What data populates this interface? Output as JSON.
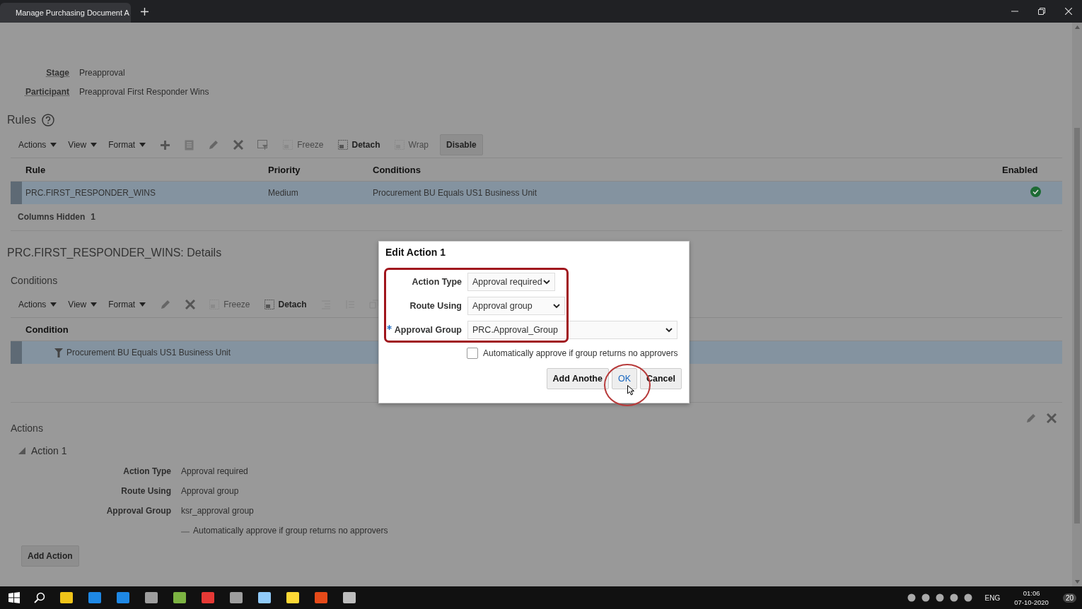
{
  "browser": {
    "tab_title": "Manage Purchasing Document A"
  },
  "header_fields": [
    {
      "label": "Stage",
      "value": "Preapproval"
    },
    {
      "label": "Participant",
      "value": "Preapproval First Responder Wins"
    }
  ],
  "rules": {
    "title": "Rules",
    "menus": [
      "Actions",
      "View",
      "Format"
    ],
    "tools": [
      {
        "label": "Freeze",
        "disabled": true
      },
      {
        "label": "Detach",
        "disabled": false
      },
      {
        "label": "Wrap",
        "disabled": true
      }
    ],
    "button": "Disable",
    "columns": [
      "Rule",
      "Priority",
      "Conditions",
      "Enabled"
    ],
    "rows": [
      {
        "rule": "PRC.FIRST_RESPONDER_WINS",
        "priority": "Medium",
        "conditions": "Procurement BU Equals US1 Business Unit",
        "enabled": true,
        "selected": true
      }
    ],
    "hidden_label": "Columns Hidden",
    "hidden_count": "1"
  },
  "details_title": "PRC.FIRST_RESPONDER_WINS: Details",
  "conditions": {
    "title": "Conditions",
    "menus": [
      "Actions",
      "View",
      "Format"
    ],
    "tools": [
      {
        "label": "Freeze",
        "disabled": true
      },
      {
        "label": "Detach",
        "disabled": false
      }
    ],
    "column": "Condition",
    "rows": [
      {
        "text": "Procurement BU Equals US1 Business Unit",
        "selected": true
      }
    ]
  },
  "actions": {
    "title": "Actions",
    "items": [
      {
        "title": "Action 1",
        "expanded": true,
        "fields": [
          {
            "label": "Action Type",
            "value": "Approval required"
          },
          {
            "label": "Route Using",
            "value": "Approval group"
          },
          {
            "label": "Approval Group",
            "value": "ksr_approval group"
          }
        ],
        "auto_approve": {
          "label": "Automatically approve if group returns no approvers",
          "checked": false
        }
      }
    ],
    "add_button": "Add Action"
  },
  "dialog": {
    "title": "Edit Action 1",
    "fields": [
      {
        "label": "Action Type",
        "value": "Approval required",
        "required": false
      },
      {
        "label": "Route Using",
        "value": "Approval group",
        "required": false
      },
      {
        "label": "Approval Group",
        "value": "PRC.Approval_Group",
        "required": true
      }
    ],
    "checkbox": {
      "label": "Automatically approve if group returns no approvers",
      "checked": false
    },
    "buttons": [
      "Add Anothe",
      "OK",
      "Cancel"
    ]
  },
  "taskbar": {
    "language": "ENG",
    "time": "01:06",
    "date": "07-10-2020",
    "notifications": "20"
  }
}
